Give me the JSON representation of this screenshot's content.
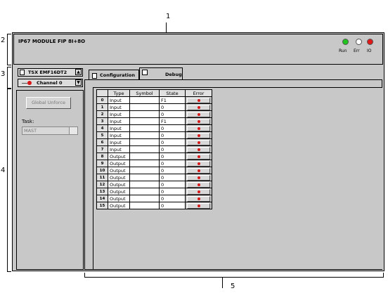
{
  "callouts": {
    "c1": "1",
    "c2": "2",
    "c3": "3",
    "c4": "4",
    "c5": "5"
  },
  "module": {
    "title": "IP67 MODULE FIP 8I+8O"
  },
  "leds": [
    {
      "label": "Run",
      "color": "#22c41e"
    },
    {
      "label": "Err",
      "color": "#ffffff"
    },
    {
      "label": "IO",
      "color": "#e01818"
    }
  ],
  "rack": {
    "module_name": "TSX EMF16DT2",
    "channel_label": "Channel 0"
  },
  "left": {
    "global_unforce": "Global Unforce",
    "task_label": "Task:",
    "task_value": "MAST"
  },
  "tabs": [
    {
      "label": "Configuration"
    },
    {
      "label": "Debug"
    }
  ],
  "table": {
    "headers": [
      "Type",
      "Symbol",
      "State",
      "Error"
    ],
    "rows": [
      {
        "idx": "0",
        "type": "Input",
        "symbol": "",
        "state": "F1"
      },
      {
        "idx": "1",
        "type": "Input",
        "symbol": "",
        "state": "0"
      },
      {
        "idx": "2",
        "type": "Input",
        "symbol": "",
        "state": "0"
      },
      {
        "idx": "3",
        "type": "Input",
        "symbol": "",
        "state": "F1"
      },
      {
        "idx": "4",
        "type": "Input",
        "symbol": "",
        "state": "0"
      },
      {
        "idx": "5",
        "type": "Input",
        "symbol": "",
        "state": "0"
      },
      {
        "idx": "6",
        "type": "Input",
        "symbol": "",
        "state": "0"
      },
      {
        "idx": "7",
        "type": "Input",
        "symbol": "",
        "state": "0"
      },
      {
        "idx": "8",
        "type": "Output",
        "symbol": "",
        "state": "0"
      },
      {
        "idx": "9",
        "type": "Output",
        "symbol": "",
        "state": "0"
      },
      {
        "idx": "10",
        "type": "Output",
        "symbol": "",
        "state": "0"
      },
      {
        "idx": "11",
        "type": "Output",
        "symbol": "",
        "state": "0"
      },
      {
        "idx": "12",
        "type": "Output",
        "symbol": "",
        "state": "0"
      },
      {
        "idx": "13",
        "type": "Output",
        "symbol": "",
        "state": "0"
      },
      {
        "idx": "14",
        "type": "Output",
        "symbol": "",
        "state": "0"
      },
      {
        "idx": "15",
        "type": "Output",
        "symbol": "",
        "state": "0"
      }
    ]
  },
  "colors": {
    "panel": "#c8c8c8",
    "err_led": "#d81818"
  }
}
